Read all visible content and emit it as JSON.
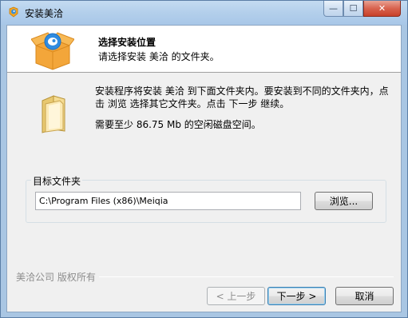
{
  "window": {
    "title": "安装美洽",
    "min_glyph": "—",
    "max_glyph": "☐",
    "close_glyph": "✕"
  },
  "header": {
    "title": "选择安装位置",
    "subtitle": "请选择安装 美洽 的文件夹。"
  },
  "body": {
    "description": "安装程序将安装 美洽 到下面文件夹内。要安装到不同的文件夹内，点击 浏览 选择其它文件夹。点击 下一步 继续。",
    "space_required": "需要至少 86.75 Mb 的空闲磁盘空间。"
  },
  "destination": {
    "label": "目标文件夹",
    "path": "C:\\Program Files (x86)\\Meiqia",
    "browse_label": "浏览..."
  },
  "footer": {
    "brand": "美洽公司 版权所有",
    "back_label": "< 上一步",
    "next_label": "下一步 >",
    "cancel_label": "取消"
  },
  "colors": {
    "accent": "#f5a623",
    "titlebar": "#b3cfeb",
    "close": "#c8412a"
  },
  "icons": {
    "title": "meiqia-app-icon",
    "header": "install-box-icon",
    "folder": "folder-icon"
  }
}
